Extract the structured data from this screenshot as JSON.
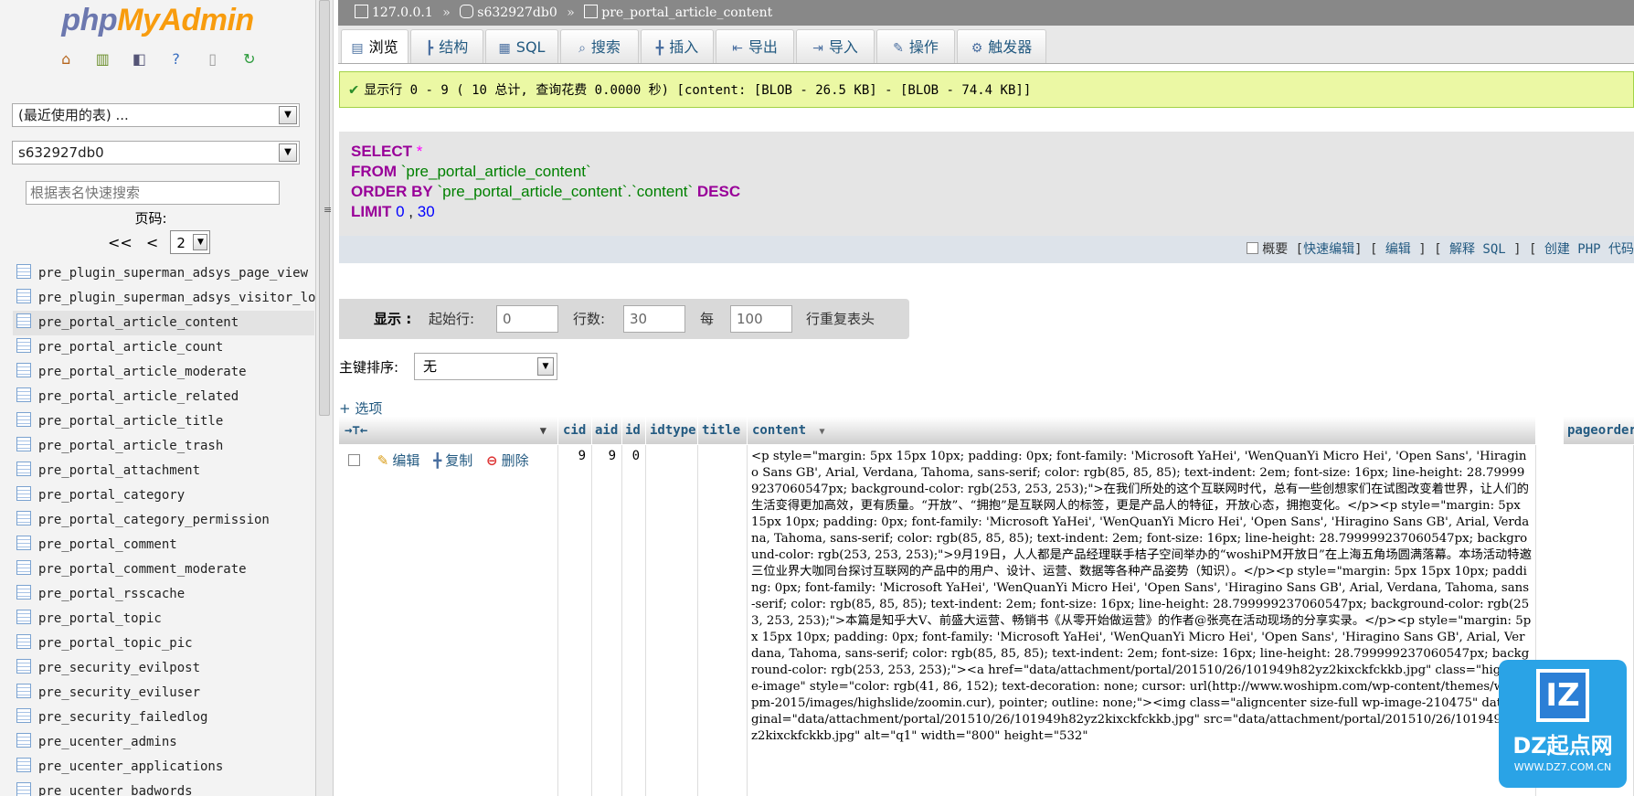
{
  "logo": {
    "part1": "php",
    "part2": "MyAdmin"
  },
  "nav": {
    "icons": [
      "home-icon",
      "exit-icon",
      "query-icon",
      "help-icon",
      "docs-icon",
      "reload-icon"
    ],
    "recent_tables": "(最近使用的表) ...",
    "database": "s632927db0",
    "filter_placeholder": "根据表名快速搜索",
    "page_label": "页码:",
    "first": "<<",
    "prev": "<",
    "page": "2",
    "tables": [
      "pre_plugin_superman_adsys_page_view",
      "pre_plugin_superman_adsys_visitor_log",
      "pre_portal_article_content",
      "pre_portal_article_count",
      "pre_portal_article_moderate",
      "pre_portal_article_related",
      "pre_portal_article_title",
      "pre_portal_article_trash",
      "pre_portal_attachment",
      "pre_portal_category",
      "pre_portal_category_permission",
      "pre_portal_comment",
      "pre_portal_comment_moderate",
      "pre_portal_rsscache",
      "pre_portal_topic",
      "pre_portal_topic_pic",
      "pre_security_evilpost",
      "pre_security_eviluser",
      "pre_security_failedlog",
      "pre_ucenter_admins",
      "pre_ucenter_applications",
      "pre_ucenter_badwords"
    ],
    "active_table": "pre_portal_article_content"
  },
  "breadcrumb": {
    "server": "127.0.0.1",
    "database": "s632927db0",
    "table": "pre_portal_article_content",
    "separator": "»"
  },
  "tabs": [
    {
      "icon": "▤",
      "label": "浏览"
    },
    {
      "icon": "┣",
      "label": "结构"
    },
    {
      "icon": "▦",
      "label": "SQL"
    },
    {
      "icon": "⌕",
      "label": "搜索"
    },
    {
      "icon": "╋",
      "label": "插入"
    },
    {
      "icon": "⇤",
      "label": "导出"
    },
    {
      "icon": "⇥",
      "label": "导入"
    },
    {
      "icon": "✎",
      "label": "操作"
    },
    {
      "icon": "⚙",
      "label": "触发器"
    }
  ],
  "success": {
    "icon": "✔",
    "text": "显示行 0 - 9 ( 10 总计, 查询花费 0.0000 秒) [content: [BLOB - 26.5 KB] - [BLOB - 74.4 KB]]"
  },
  "sql": {
    "line1_kw": "SELECT",
    "line1_op": " *",
    "line2_kw": "FROM",
    "line2_ident": " `pre_portal_article_content`",
    "line3_kw": "ORDER BY",
    "line3_ident": " `pre_portal_article_content`.`content`",
    "line3_kw2": " DESC",
    "line4_kw": "LIMIT",
    "line4_num1": " 0",
    "line4_sep": " ,",
    "line4_num2": " 30"
  },
  "sql_tools": {
    "profiling": "概要",
    "inline_edit": "快速编辑",
    "edit": "编辑",
    "explain": "解释 SQL",
    "create_php": "创建 PHP 代码"
  },
  "display": {
    "label": "显示 :",
    "start_label": "起始行:",
    "start_value": "0",
    "rows_label": "行数:",
    "rows_value": "30",
    "every_label": "每",
    "repeat_value": "100",
    "repeat_label": "行重复表头"
  },
  "sort": {
    "label": "主键排序:",
    "value": "无"
  },
  "options_link": "+ 选项",
  "columns": {
    "arrows": "→⊤←",
    "cid": "cid",
    "aid": "aid",
    "id": "id",
    "idtype": "idtype",
    "title": "title",
    "content": "content",
    "pageorder": "pageorder"
  },
  "row": {
    "edit": "编辑",
    "copy": "复制",
    "delete": "删除",
    "cid": "9",
    "aid": "9",
    "id": "0",
    "idtype": "",
    "title": "",
    "content": "<p style=\"margin: 5px 15px 10px; padding: 0px; font-family: 'Microsoft YaHei', 'WenQuanYi Micro Hei', 'Open Sans', 'Hiragino Sans GB', Arial, Verdana, Tahoma, sans-serif; color: rgb(85, 85, 85); text-indent: 2em; font-size: 16px; line-height: 28.799999237060547px; background-color: rgb(253, 253, 253);\">在我们所处的这个互联网时代，总有一些创想家们在试图改变着世界，让人们的生活变得更加高效，更有质量。“开放”、“拥抱”是互联网人的标签，更是产品人的特征，开放心态，拥抱变化。</p><p style=\"margin: 5px 15px 10px; padding: 0px; font-family: 'Microsoft YaHei', 'WenQuanYi Micro Hei', 'Open Sans', 'Hiragino Sans GB', Arial, Verdana, Tahoma, sans-serif; color: rgb(85, 85, 85); text-indent: 2em; font-size: 16px; line-height: 28.799999237060547px; background-color: rgb(253, 253, 253);\">9月19日，人人都是产品经理联手桔子空间举办的“woshiPM开放日”在上海五角场圆满落幕。本场活动特邀三位业界大咖同台探讨互联网的产品中的用户、设计、运营、数据等各种产品姿势（知识）。</p><p style=\"margin: 5px 15px 10px; padding: 0px; font-family: 'Microsoft YaHei', 'WenQuanYi Micro Hei', 'Open Sans', 'Hiragino Sans GB', Arial, Verdana, Tahoma, sans-serif; color: rgb(85, 85, 85); text-indent: 2em; font-size: 16px; line-height: 28.799999237060547px; background-color: rgb(253, 253, 253);\">本篇是知乎大V、前盛大运营、畅销书《从零开始做运营》的作者@张亮在活动现场的分享实录。</p><p style=\"margin: 5px 15px 10px; padding: 0px; font-family: 'Microsoft YaHei', 'WenQuanYi Micro Hei', 'Open Sans', 'Hiragino Sans GB', Arial, Verdana, Tahoma, sans-serif; color: rgb(85, 85, 85); text-indent: 2em; font-size: 16px; line-height: 28.799999237060547px; background-color: rgb(253, 253, 253);\"><a href=\"data/attachment/portal/201510/26/101949h82yz2kixckfckkb.jpg\" class=\"highslide-image\" style=\"color: rgb(41, 86, 152); text-decoration: none; cursor: url(http://www.woshipm.com/wp-content/themes/woshipm-2015/images/highslide/zoomin.cur), pointer; outline: none;\"><img class=\"aligncenter size-full wp-image-210475\" data-original=\"data/attachment/portal/201510/26/101949h82yz2kixckfckkb.jpg\" src=\"data/attachment/portal/201510/26/101949h82yz2kixckfckkb.jpg\" alt=\"q1\" width=\"800\" height=\"532\""
  },
  "watermark": {
    "logo": "IZ",
    "title": "DZ起点网",
    "url": "WWW.DZ7.COM.CN"
  }
}
